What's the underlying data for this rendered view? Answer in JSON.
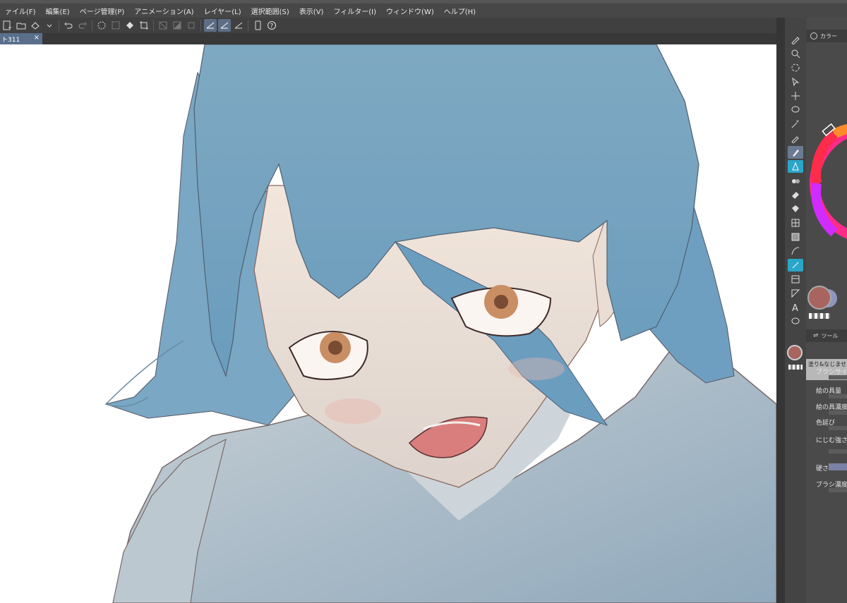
{
  "menu": [
    "ァイル(F)",
    "編集(E)",
    "ページ管理(P)",
    "アニメーション(A)",
    "レイヤー(L)",
    "選択範囲(S)",
    "表示(V)",
    "フィルター(I)",
    "ウィンドウ(W)",
    "ヘルプ(H)"
  ],
  "document_tab": {
    "label": "ト311",
    "close": "×"
  },
  "right_panel": {
    "color_panel_title": "カラー",
    "tool_property_title": "ツール",
    "brush_name": "塗り&なじませ",
    "properties": [
      "ブラシサイズ",
      "絵の具量",
      "絵の具濃度",
      "色延び",
      "にじむ強さ",
      "硬さ",
      "ブラシ濃度"
    ]
  },
  "colors": {
    "main_color": "#a8655f",
    "sub_color": "#8e96c0",
    "accent": "#5d6e85"
  },
  "icons": [
    "new-file-icon",
    "open-icon",
    "save-icon",
    "undo-icon",
    "redo-icon",
    "brush-icon",
    "pen-icon",
    "zoom-icon",
    "eraser-icon",
    "fill-icon",
    "text-icon"
  ]
}
